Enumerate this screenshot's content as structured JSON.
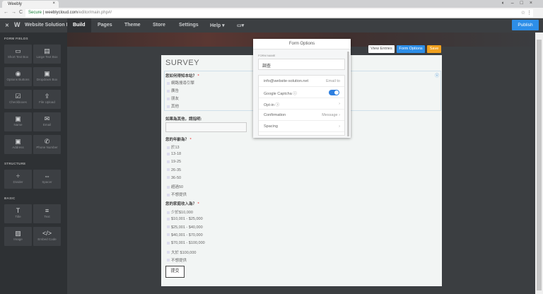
{
  "browser": {
    "tab_title": "Weebly",
    "url_secure": "Secure",
    "url_host": "weeblycloud.com",
    "url_path": "/editor/main.php#/"
  },
  "topbar": {
    "site_name": "Website Solution Li...",
    "tabs": [
      "Build",
      "Pages",
      "Theme",
      "Store",
      "Settings",
      "Help ▾"
    ],
    "publish": "Publish"
  },
  "sidebar": {
    "sections": [
      {
        "title": "FORM FIELDS",
        "items": [
          {
            "label": "Short Text Box",
            "icon": "▭"
          },
          {
            "label": "Large Text Box",
            "icon": "▤"
          },
          {
            "label": "Options Buttons",
            "icon": "◉"
          },
          {
            "label": "Dropdown Box",
            "icon": "▣"
          },
          {
            "label": "Checkboxes",
            "icon": "☑"
          },
          {
            "label": "File Upload",
            "icon": "⇪"
          },
          {
            "label": "Name",
            "icon": "▣"
          },
          {
            "label": "Email",
            "icon": "✉"
          },
          {
            "label": "Address",
            "icon": "▣"
          },
          {
            "label": "Phone Number",
            "icon": "✆"
          }
        ]
      },
      {
        "title": "STRUCTURE",
        "items": [
          {
            "label": "Divider",
            "icon": "÷"
          },
          {
            "label": "Spacer",
            "icon": "⇔"
          }
        ]
      },
      {
        "title": "BASIC",
        "items": [
          {
            "label": "Title",
            "icon": "T"
          },
          {
            "label": "Text",
            "icon": "≡"
          },
          {
            "label": "Image",
            "icon": "▨"
          },
          {
            "label": "Embed Code",
            "icon": "</>"
          }
        ]
      }
    ]
  },
  "toolbar": {
    "view_entries": "View Entries",
    "form_options": "Form Options",
    "save": "Save"
  },
  "form": {
    "title": "SURVEY",
    "q1": "您如何得知本站？",
    "q1_options": [
      "網路搜尋引擎",
      "廣告",
      "朋友",
      "其他"
    ],
    "q2": "如果為其他，請指明:",
    "q3": "您的年齡為？",
    "q3_options": [
      "於13",
      "13-18",
      "19-25",
      "26-35",
      "36-50",
      "超過50",
      "不想提供"
    ],
    "q4": "您的家庭收入為？",
    "q4_options": [
      "少於$10,000",
      "$10,001 - $25,000",
      "$25,001 - $40,000",
      "$40,001 - $70,000",
      "$70,001 - $100,000",
      "大於 $100,000",
      "不想提供"
    ],
    "required": "*",
    "submit": "提交"
  },
  "popup": {
    "title": "Form Options",
    "form_name_label": "FORM NAME",
    "form_name": "調查",
    "email": "info@website-solution.net",
    "email_label": "Email to",
    "captcha": "Google Captcha",
    "captcha_on": true,
    "optin": "Opt-in",
    "confirmation": "Confirmation",
    "confirmation_value": "Message",
    "spacing": "Spacing"
  }
}
